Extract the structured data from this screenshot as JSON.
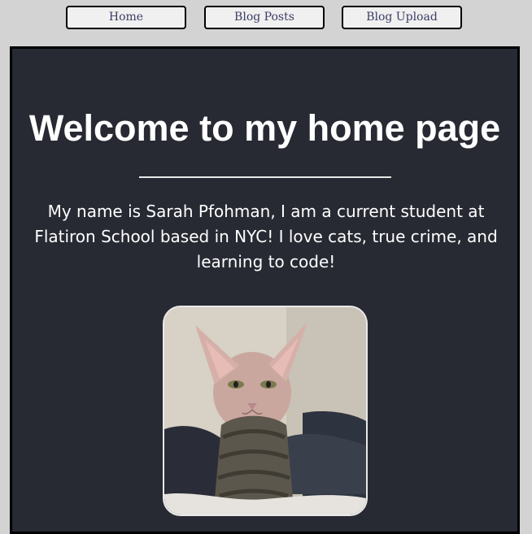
{
  "nav": {
    "home_label": "Home",
    "posts_label": "Blog Posts",
    "upload_label": "Blog Upload"
  },
  "main": {
    "title": "Welcome to my home page",
    "intro": "My name is Sarah Pfohman, I am a current student at Flatiron School based in NYC! I love cats, true crime, and learning to code!"
  },
  "colors": {
    "page_bg": "#d3d3d3",
    "content_bg": "#272a33",
    "nav_button_bg": "#f0f0f0",
    "nav_text": "#3c3c66",
    "heading_text": "#ffffff"
  }
}
